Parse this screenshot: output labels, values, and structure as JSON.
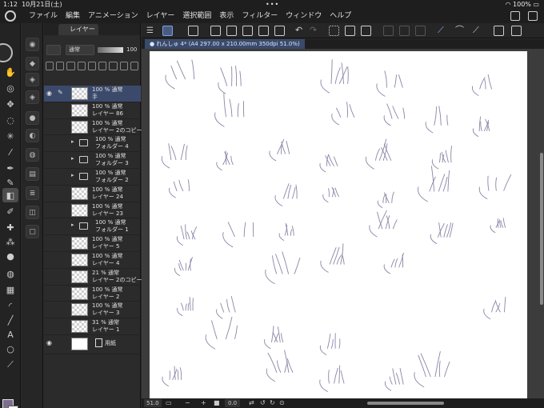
{
  "status": {
    "time": "1:12",
    "date": "10月21日(土)",
    "dots": "•••",
    "battery": "100%"
  },
  "menu": {
    "items": [
      "ファイル",
      "編集",
      "アニメーション",
      "レイヤー",
      "選択範囲",
      "表示",
      "フィルター",
      "ウィンドウ",
      "ヘルプ"
    ]
  },
  "layer_panel": {
    "tab_label": "レイヤー",
    "blend_mode": "通常",
    "opacity": "100",
    "layers": [
      {
        "opacity": "100 %",
        "mode": "通常",
        "name": "手",
        "type": "raster",
        "selected": true,
        "visible": true
      },
      {
        "opacity": "100 %",
        "mode": "通常",
        "name": "レイヤー 86",
        "type": "raster"
      },
      {
        "opacity": "100 %",
        "mode": "通常",
        "name": "レイヤー 2のコピー",
        "type": "raster"
      },
      {
        "opacity": "100 %",
        "mode": "通常",
        "name": "フォルダー 4",
        "type": "folder"
      },
      {
        "opacity": "100 %",
        "mode": "通常",
        "name": "フォルダー 3",
        "type": "folder"
      },
      {
        "opacity": "100 %",
        "mode": "通常",
        "name": "フォルダー 2",
        "type": "folder"
      },
      {
        "opacity": "100 %",
        "mode": "通常",
        "name": "レイヤー 24",
        "type": "raster"
      },
      {
        "opacity": "100 %",
        "mode": "通常",
        "name": "レイヤー 23",
        "type": "raster"
      },
      {
        "opacity": "100 %",
        "mode": "通常",
        "name": "フォルダー 1",
        "type": "folder"
      },
      {
        "opacity": "100 %",
        "mode": "通常",
        "name": "レイヤー 5",
        "type": "raster"
      },
      {
        "opacity": "100 %",
        "mode": "通常",
        "name": "レイヤー 4",
        "type": "raster"
      },
      {
        "opacity": "21 %",
        "mode": "通常",
        "name": "レイヤー 2のコピー",
        "type": "raster"
      },
      {
        "opacity": "100 %",
        "mode": "通常",
        "name": "レイヤー 2",
        "type": "raster"
      },
      {
        "opacity": "100 %",
        "mode": "通常",
        "name": "レイヤー 3",
        "type": "raster"
      },
      {
        "opacity": "31 %",
        "mode": "通常",
        "name": "レイヤー 1",
        "type": "raster"
      },
      {
        "name": "用紙",
        "type": "paper",
        "visible": true
      }
    ]
  },
  "document": {
    "tab_title": "● れんしゅ 4* (A4 297.00 x 210.00mm 350dpi 51.0%)"
  },
  "bottom": {
    "zoom": "51.0",
    "rotation": "0.0"
  },
  "colors": {
    "main": "#7c6e8f",
    "sub": "#ffffff",
    "selected_layer": "#3b4a6b",
    "sketch_stroke": "#8c84a6"
  }
}
